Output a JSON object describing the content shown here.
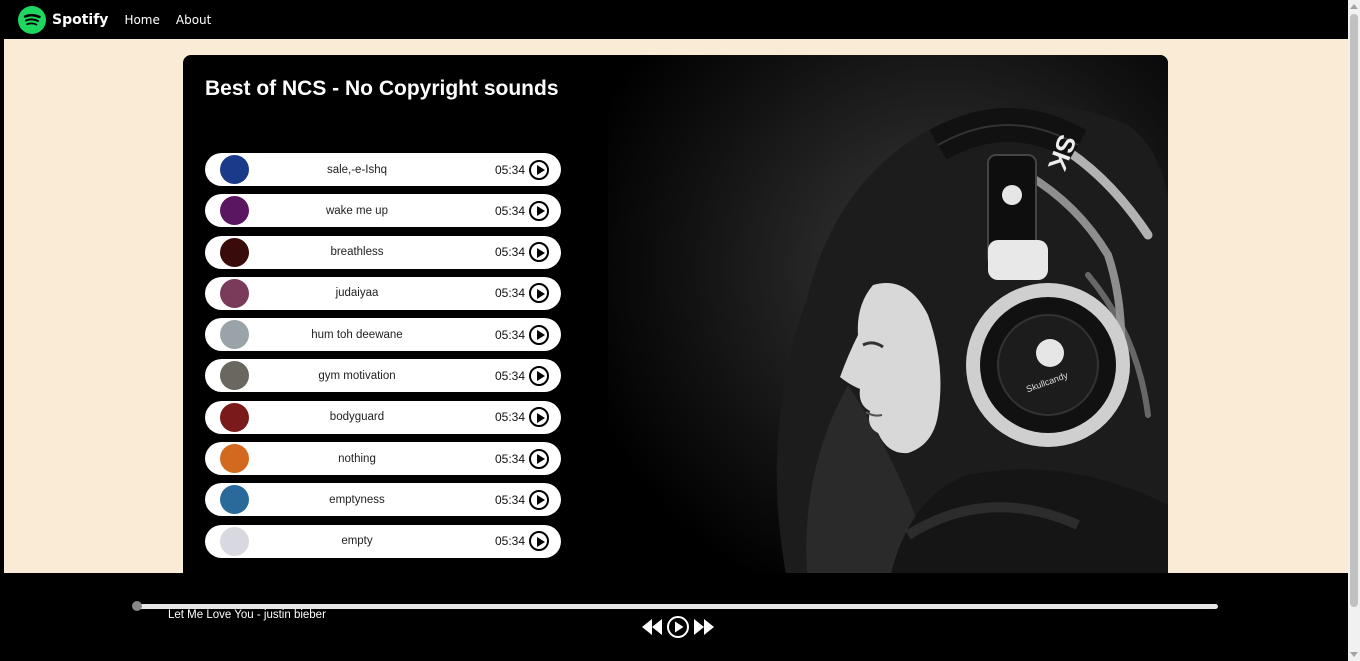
{
  "navbar": {
    "brand": "Spotify",
    "links": [
      "Home",
      "About"
    ]
  },
  "playlist": {
    "title": "Best of NCS - No Copyright sounds",
    "songs": [
      {
        "name": "sale,-e-Ishq",
        "duration": "05:34",
        "thumb": "#1a3a8a"
      },
      {
        "name": "wake me up",
        "duration": "05:34",
        "thumb": "#5a1660"
      },
      {
        "name": "breathless",
        "duration": "05:34",
        "thumb": "#3a0b0b"
      },
      {
        "name": "judaiyaa",
        "duration": "05:34",
        "thumb": "#7a3a5a"
      },
      {
        "name": "hum toh deewane",
        "duration": "05:34",
        "thumb": "#9aa4a8"
      },
      {
        "name": "gym motivation",
        "duration": "05:34",
        "thumb": "#6a6660"
      },
      {
        "name": "bodyguard",
        "duration": "05:34",
        "thumb": "#7a1a1a"
      },
      {
        "name": "nothing",
        "duration": "05:34",
        "thumb": "#d2691e"
      },
      {
        "name": "emptyness",
        "duration": "05:34",
        "thumb": "#2a6a9a"
      },
      {
        "name": "empty",
        "duration": "05:34",
        "thumb": "#d8d8e0"
      }
    ]
  },
  "player": {
    "now_playing": "Let Me Love You - justin bieber",
    "progress": 0
  },
  "colors": {
    "brand": "#1ed760",
    "background": "#faebd7"
  }
}
